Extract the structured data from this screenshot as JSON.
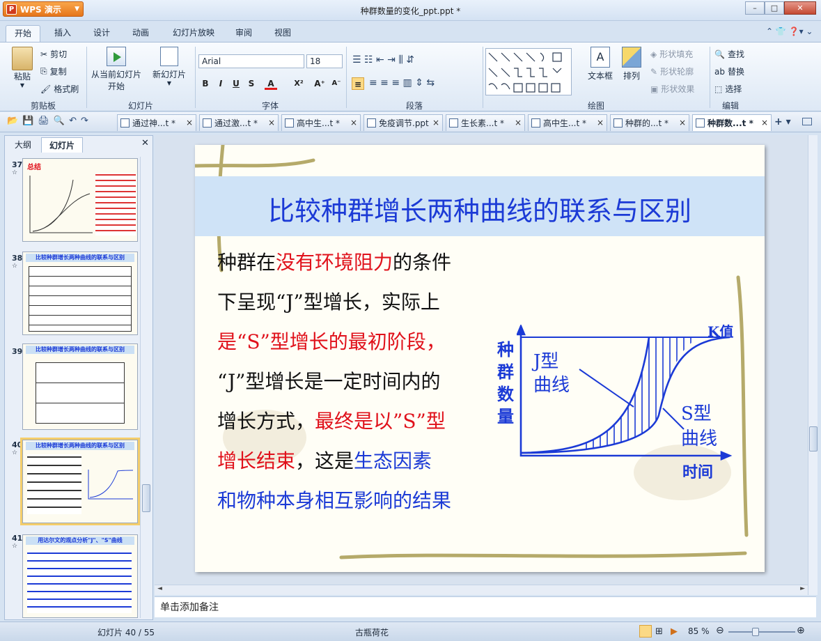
{
  "app": {
    "name": "WPS 演示",
    "doc_title": "种群数量的变化_ppt.ppt *"
  },
  "ribbon_tabs": [
    "开始",
    "插入",
    "设计",
    "动画",
    "幻灯片放映",
    "审阅",
    "视图"
  ],
  "clipboard": {
    "paste": "粘贴",
    "cut": "剪切",
    "copy": "复制",
    "format_painter": "格式刷",
    "group": "剪贴板"
  },
  "slides_group": {
    "from_current": "从当前幻灯片",
    "start": "开始",
    "new_slide": "新幻灯片",
    "group": "幻灯片"
  },
  "font": {
    "name": "Arial",
    "size": "18",
    "group": "字体"
  },
  "paragraph": {
    "group": "段落"
  },
  "drawing": {
    "textbox": "文本框",
    "arrange": "排列",
    "fill": "形状填充",
    "outline": "形状轮廓",
    "effect": "形状效果",
    "group": "绘图"
  },
  "edit": {
    "find": "查找",
    "replace": "替换",
    "select": "选择",
    "group": "编辑"
  },
  "doc_tabs": [
    "通过神...t *",
    "通过激...t *",
    "高中生...t *",
    "免疫调节.ppt",
    "生长素...t *",
    "高中生...t *",
    "种群的...t *",
    "种群数...t *"
  ],
  "panel_tabs": {
    "outline": "大纲",
    "slides": "幻灯片"
  },
  "thumbnails": [
    {
      "num": "37",
      "title": "总结"
    },
    {
      "num": "38",
      "title": "比较种群增长两种曲线的联系与区别"
    },
    {
      "num": "39",
      "title": "比较种群增长两种曲线的联系与区别"
    },
    {
      "num": "40",
      "title": "比较种群增长两种曲线的联系与区别"
    },
    {
      "num": "41",
      "title": "用达尔文的观点分析\"J\"、\"S\"曲线"
    }
  ],
  "slide": {
    "title": "比较种群增长两种曲线的联系与区别",
    "l1a": "种群在",
    "l1b": "没有环境阻力",
    "l1c": "的条件",
    "l2": "下呈现“J”型增长，实际上",
    "l3": "是“S”型增长的最初阶段，",
    "l4": "“J”型增长是一定时间内的",
    "l5a": "增长方式，",
    "l5b": "最终是以”S”型",
    "l6a": "增长结束",
    "l6b": "，这是",
    "l6c": "生态因素",
    "l7": "和物种本身相互影响的结果",
    "chart": {
      "ylabel": [
        "种",
        "群",
        "数",
        "量"
      ],
      "xlabel": "时间",
      "k": "K值",
      "j1": "J型",
      "j2": "曲线",
      "s1": "S型",
      "s2": "曲线"
    }
  },
  "notes_placeholder": "单击添加备注",
  "status": {
    "slide_counter": "幻灯片 40 / 55",
    "theme": "古瓶荷花",
    "zoom": "85 %"
  },
  "colors": {
    "accent": "#1b3ad6",
    "highlight": "#e0111b"
  }
}
